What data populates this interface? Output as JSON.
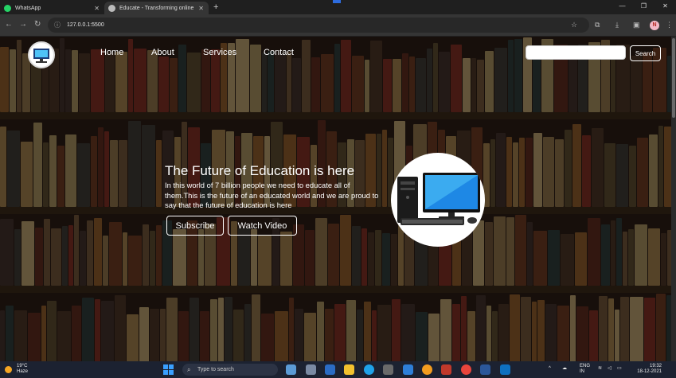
{
  "browser": {
    "tabs": [
      {
        "label": "WhatsApp",
        "active": false,
        "favicon_color": "#25d366"
      },
      {
        "label": "Educate - Transforming online",
        "active": true,
        "favicon_color": "#bbbbbb"
      }
    ],
    "new_tab_label": "+",
    "url": "127.0.0.1:5500",
    "profile_initial": "N"
  },
  "site": {
    "nav": [
      {
        "label": "Home"
      },
      {
        "label": "About"
      },
      {
        "label": "Services"
      },
      {
        "label": "Contact"
      }
    ],
    "search_placeholder": "",
    "search_button": "Search",
    "hero": {
      "title": "The Future of Education is here",
      "text": "In this world of 7 billion people we need to educate all of them.This is the future of an educated world and we are proud to say that the future of education is here",
      "subscribe": "Subscribe",
      "watch_video": "Watch Video"
    }
  },
  "taskbar": {
    "weather_temp": "19°C",
    "weather_desc": "Haze",
    "search_placeholder": "Type to search",
    "lang_top": "ENG",
    "lang_bottom": "IN",
    "time": "19:32",
    "date": "18-12-2021"
  },
  "colors": {
    "accent": "#3aa0ff",
    "tabbar": "#1f1f1f",
    "taskbar": "#1c2231"
  }
}
